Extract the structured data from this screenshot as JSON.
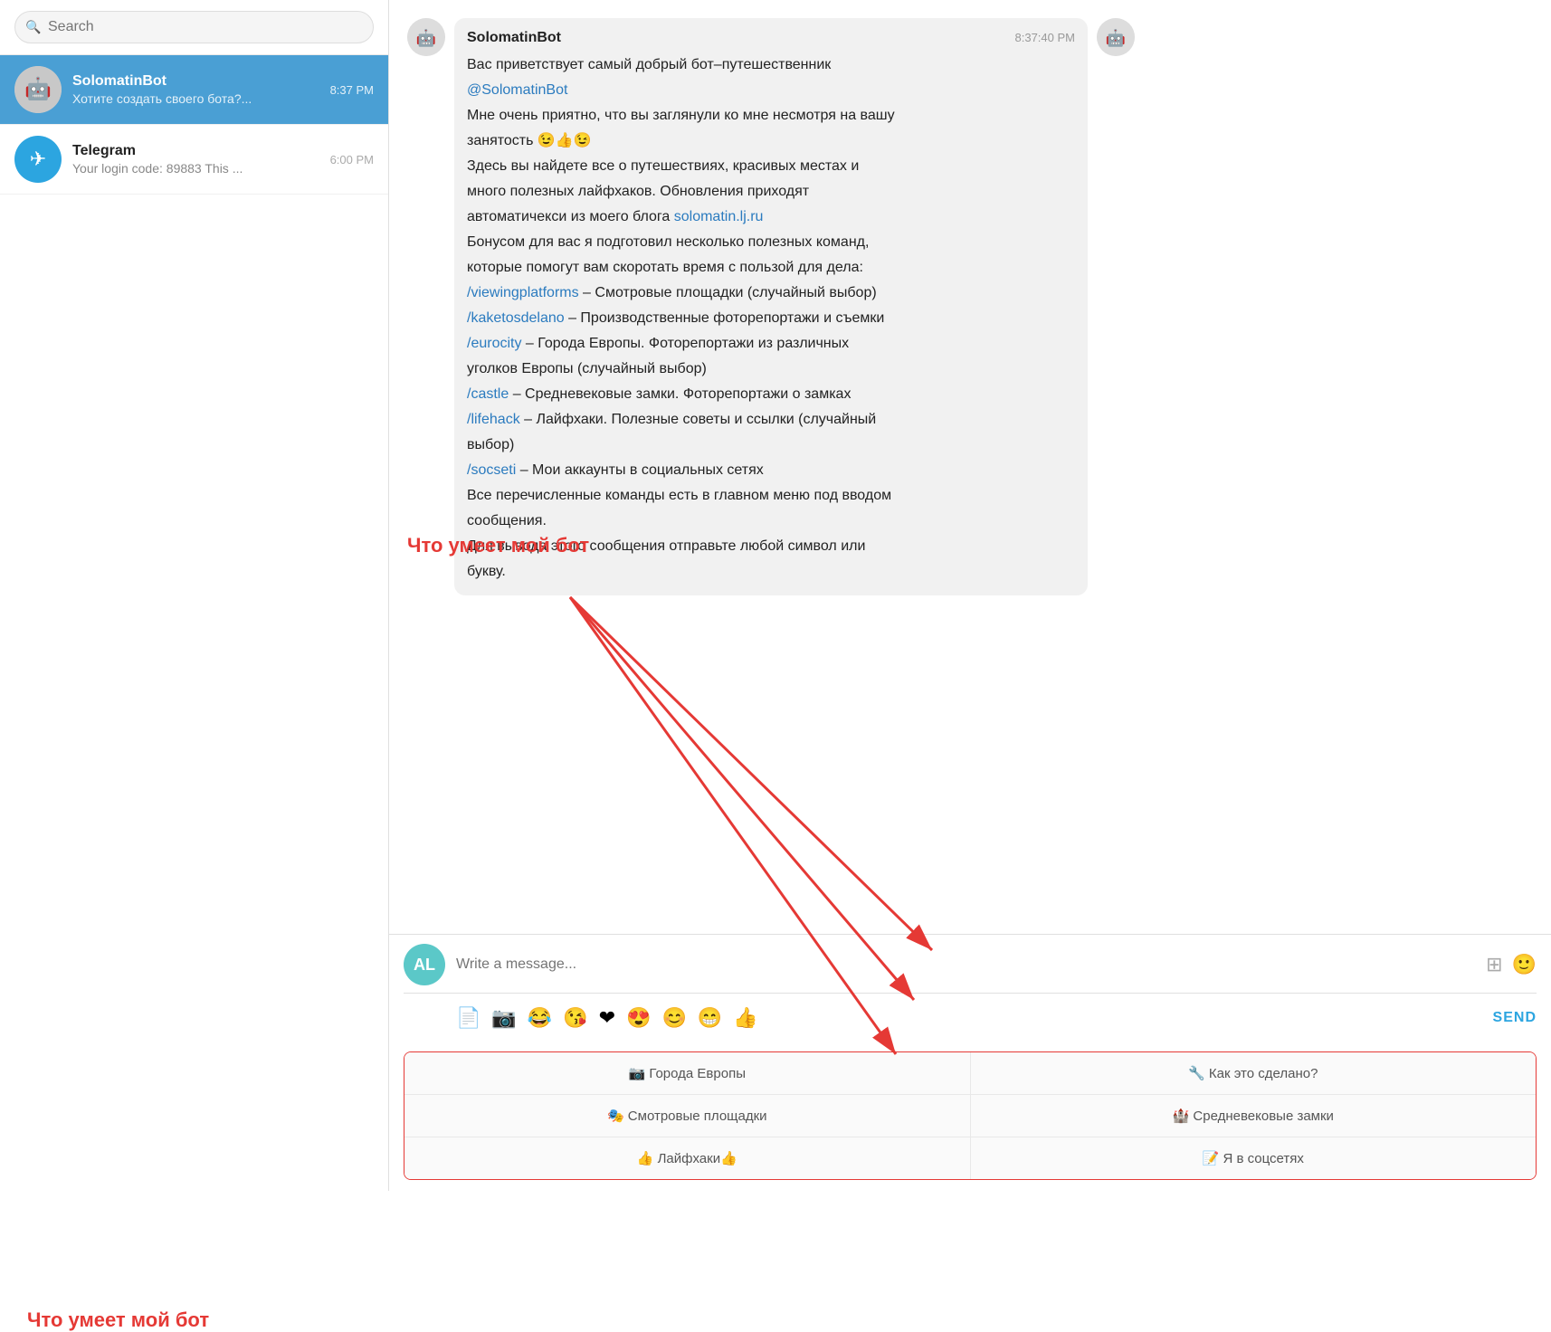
{
  "sidebar": {
    "search_placeholder": "Search",
    "chats": [
      {
        "id": "solomatinbot",
        "name": "SolomatinBot",
        "preview": "Хотите создать своего бота?...",
        "time": "8:37 PM",
        "active": true,
        "avatar_type": "bot",
        "avatar_text": "🤖"
      },
      {
        "id": "telegram",
        "name": "Telegram",
        "preview": "Your login code: 89883 This ...",
        "time": "6:00 PM",
        "active": false,
        "avatar_type": "telegram",
        "avatar_text": "✈"
      }
    ]
  },
  "main_chat": {
    "bot_name": "SolomatinBot",
    "msg_time": "8:37:40 PM",
    "message": {
      "greeting": "Вас приветствует самый добрый бот–путешественник",
      "mention": "@SolomatinBot",
      "line1": "Мне очень приятно, что вы заглянули ко мне несмотря на вашу",
      "emojis": "занятость 😉👍😉",
      "line2": "Здесь вы найдете все о путешествиях, красивых местах и",
      "line3": "много полезных лайфхаков. Обновления приходят",
      "line4": "автоматичекси из моего блога",
      "blog_link": "solomatin.lj.ru",
      "line5": "Бонусом для вас я подготовил несколько полезных команд,",
      "line6": "которые помогут вам скоротать время с пользой для дела:",
      "cmd1_link": "/viewingplatforms",
      "cmd1_text": " – Смотровые площадки (случайный выбор)",
      "cmd2_link": "/kaketosdelano",
      "cmd2_text": " – Производственные фоторепортажи и съемки",
      "cmd3_link": "/eurocity",
      "cmd3_text": " – Города Европы. Фоторепортажи из различных",
      "cmd3_cont": "уголков Европы (случайный выбор)",
      "cmd4_link": "/castle",
      "cmd4_text": " – Средневековые замки. Фоторепортажи о замках",
      "cmd5_link": "/lifehack",
      "cmd5_text": " – Лайфхаки. Полезные советы и ссылки (случайный",
      "cmd5_cont": "выбор)",
      "cmd6_link": "/socseti",
      "cmd6_text": " – Мои аккаунты в социальных сетях",
      "footer1": "Все перечисленные команды есть в главном меню под вводом",
      "footer2": "сообщения.",
      "footer3": "Для вывода этого сообщения отправьте любой символ или",
      "footer4": "букву."
    }
  },
  "input": {
    "placeholder": "Write a message...",
    "user_initials": "AL",
    "send_label": "SEND",
    "emojis": [
      "😂",
      "😘",
      "❤",
      "😍",
      "😊",
      "😁",
      "👍"
    ]
  },
  "keyboard": {
    "buttons": [
      [
        "📷 Города Европы",
        "🔧 Как это сделано?"
      ],
      [
        "🎭 Смотровые площадки",
        "🏰 Средневековые замки"
      ],
      [
        "👍 Лайфхаки👍",
        "📝 Я в соцсетях"
      ]
    ]
  },
  "annotation": {
    "text": "Что умеет мой бот"
  }
}
